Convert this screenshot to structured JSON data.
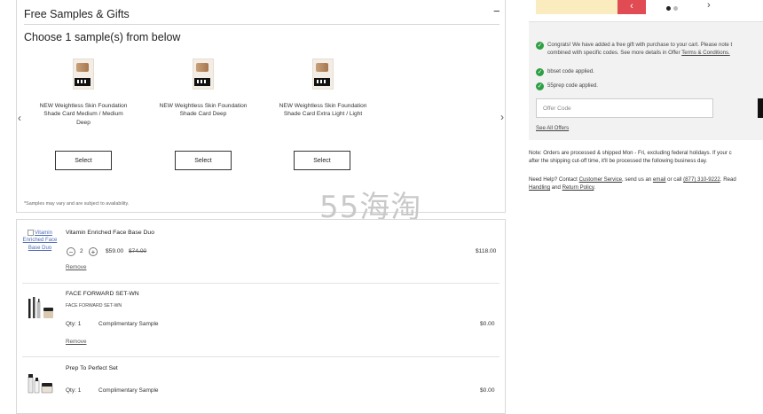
{
  "samples": {
    "title": "Free Samples & Gifts",
    "collapse_symbol": "−",
    "subtitle": "Choose 1 sample(s) from below",
    "items": [
      {
        "name": "NEW Weightless Skin Foundation Shade Card Medium / Medium Deep",
        "select_label": "Select"
      },
      {
        "name": "NEW Weightless Skin Foundation Shade Card Deep",
        "select_label": "Select"
      },
      {
        "name": "NEW Weightless Skin Foundation Shade Card Extra Light / Light",
        "select_label": "Select"
      }
    ],
    "prev_arrow": "‹",
    "next_arrow": "›",
    "disclaimer": "*Samples may vary and are subject to availability."
  },
  "watermark": "55海淘",
  "cart": {
    "items": [
      {
        "image_alt": "Vitamin Enriched Face Base Duo",
        "title": "Vitamin Enriched Face Base Duo",
        "qty_value": "2",
        "qty_minus": "−",
        "qty_plus": "+",
        "sale_price": "$59.00",
        "original_price": "$74.00",
        "total": "$118.00",
        "remove_label": "Remove"
      },
      {
        "title": "FACE FORWARD SET-WN",
        "subtitle": "FACE FORWARD SET-WN",
        "qty_label": "Qty: 1",
        "note": "Complimentary Sample",
        "total": "$0.00",
        "remove_label": "Remove"
      },
      {
        "title": "Prep To Perfect Set",
        "qty_label": "Qty: 1",
        "note": "Complimentary Sample",
        "total": "$0.00"
      }
    ]
  },
  "carousel": {
    "prev": "‹",
    "next": "›"
  },
  "summary": {
    "messages": {
      "gift_msg_1": "Congrats! We have added a free gift with purchase to your cart. Please note t",
      "gift_msg_2_prefix": "combined with specific codes. See more details in Offer ",
      "gift_msg_2_link": "Terms & Conditions.",
      "code_1": "bbset code applied.",
      "code_2": "55prep code applied."
    },
    "offer_placeholder": "Offer Code",
    "see_all_offers": "See All Offers"
  },
  "notes": {
    "shipping_1": "Note: Orders are processed & shipped Mon - Fri, excluding federal holidays. If your c",
    "shipping_2": "after the shipping cut-off time, it'll be processed the following business day.",
    "help_prefix": "Need Help? Contact ",
    "help_customer_service": "Customer Service",
    "help_mid1": ", send us an ",
    "help_email": "email",
    "help_mid2": " or call ",
    "help_phone": "(877) 310-9222",
    "help_mid3": ". Read",
    "help_handling": "Handling",
    "help_and": " and ",
    "help_return_policy": "Return Policy",
    "help_end": "."
  },
  "colors": {
    "promo_yellow": "#fbecc0",
    "promo_red": "#e04b54",
    "success_green": "#2f9e44"
  }
}
